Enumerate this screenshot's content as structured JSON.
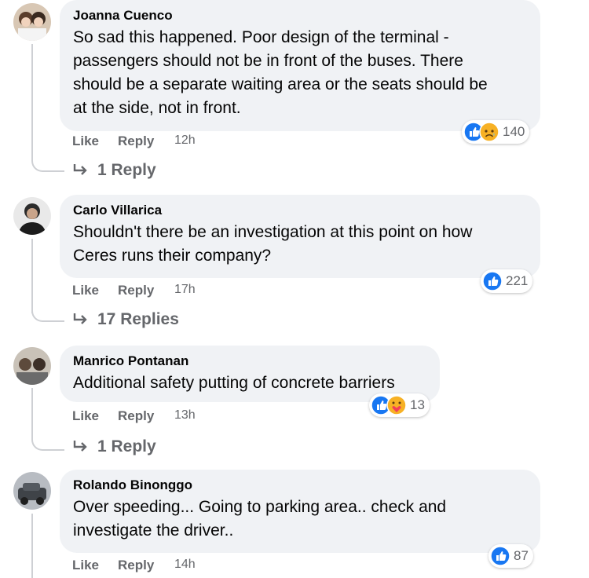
{
  "colors": {
    "bubble": "#f0f2f5",
    "meta_text": "#65676b",
    "like_blue": "#1877f2",
    "thread_line": "#ced0d4"
  },
  "comments": [
    {
      "author": "Joanna Cuenco",
      "text_lines": [
        "So sad this happened. Poor design of the terminal -",
        "passengers should not be in front of the buses. There",
        "should be a separate waiting area or the seats should be",
        "at the side, not in front."
      ],
      "like": "Like",
      "reply": "Reply",
      "time": "12h",
      "reactions": [
        "like-icon",
        "sad-icon"
      ],
      "reaction_count": "140",
      "replies_label": "1 Reply"
    },
    {
      "author": "Carlo Villarica",
      "text_lines": [
        "Shouldn't there be an investigation at this point on how",
        "Ceres runs their company?"
      ],
      "like": "Like",
      "reply": "Reply",
      "time": "17h",
      "reactions": [
        "like-icon"
      ],
      "reaction_count": "221",
      "replies_label": "17 Replies"
    },
    {
      "author": "Manrico Pontanan",
      "text_lines": [
        "Additional safety putting of concrete barriers"
      ],
      "like": "Like",
      "reply": "Reply",
      "time": "13h",
      "reactions": [
        "like-icon",
        "care-icon"
      ],
      "reaction_count": "13",
      "replies_label": "1 Reply"
    },
    {
      "author": "Rolando Binonggo",
      "text_lines": [
        "Over speeding... Going to parking area.. check and",
        "investigate the driver.."
      ],
      "like": "Like",
      "reply": "Reply",
      "time": "14h",
      "reactions": [
        "like-icon"
      ],
      "reaction_count": "87"
    }
  ]
}
